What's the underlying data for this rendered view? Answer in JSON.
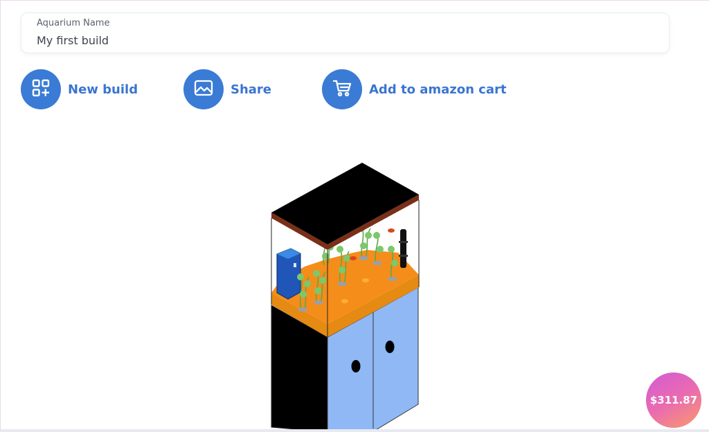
{
  "form": {
    "name_label": "Aquarium Name",
    "name_value": "My first build"
  },
  "actions": [
    {
      "label": "New build",
      "icon": "grid-plus-icon"
    },
    {
      "label": "Share",
      "icon": "image-icon"
    },
    {
      "label": "Add to amazon cart",
      "icon": "cart-icon"
    }
  ],
  "price": {
    "total": "$311.87"
  },
  "colors": {
    "accent": "#3a7bd5",
    "label_text": "#3a75d0",
    "cabinet_door": "#8fb8f5",
    "substrate": "#f58d1a",
    "price_gradient_start": "#d35ad6",
    "price_gradient_end": "#f99b6a"
  }
}
